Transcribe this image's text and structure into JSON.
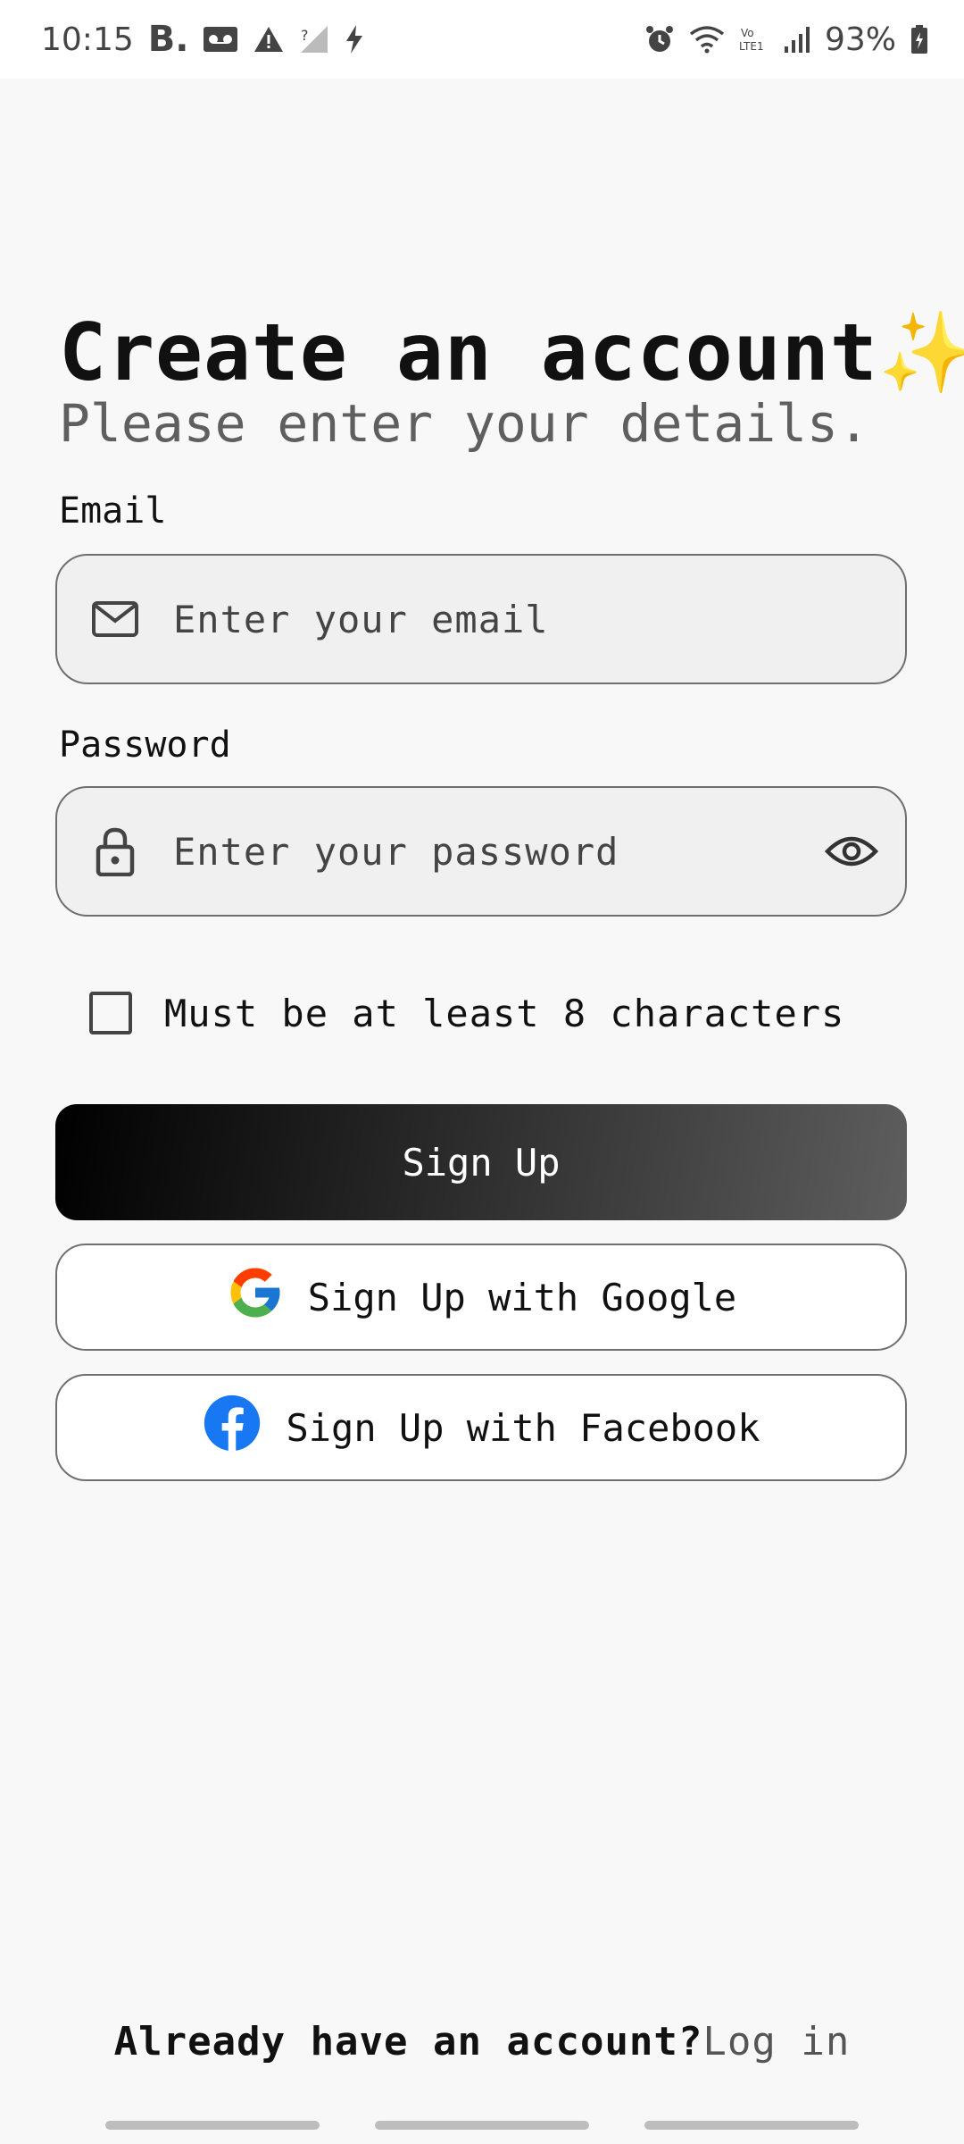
{
  "status_bar": {
    "time": "10:15",
    "b_label": "B.",
    "battery": "93%",
    "icons": [
      "voicemail-icon",
      "warning-icon",
      "no-signal-icon",
      "charging-icon",
      "alarm-icon",
      "wifi-icon",
      "volte-icon",
      "signal-icon",
      "battery-icon"
    ]
  },
  "header": {
    "title": "Create an account✨",
    "subtitle": "Please enter your details."
  },
  "form": {
    "email_label": "Email",
    "email_placeholder": "Enter your email",
    "password_label": "Password",
    "password_placeholder": "Enter your password",
    "requirement": "Must be at least 8 characters",
    "requirement_checked": false
  },
  "buttons": {
    "signup": "Sign Up",
    "google": "Sign Up with Google",
    "facebook": "Sign Up with Facebook"
  },
  "footer": {
    "prompt": "Already have an account?",
    "login": "Log in"
  },
  "colors": {
    "background": "#f8f8f8",
    "button_start": "#000000",
    "button_end": "#5e5e5e",
    "facebook_blue": "#1877f2"
  }
}
